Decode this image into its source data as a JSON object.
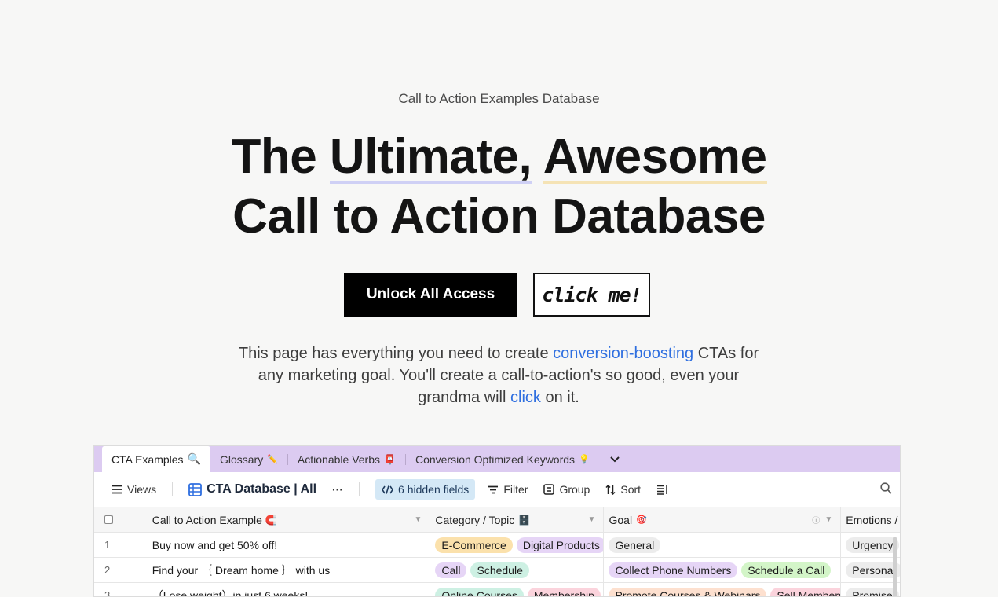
{
  "hero": {
    "eyebrow": "Call to Action Examples Database",
    "title_part1": "The ",
    "title_hl1": "Ultimate,",
    "title_space": " ",
    "title_hl2": "Awesome",
    "title_line2": "Call to Action Database",
    "primary_button": "Unlock All Access",
    "secondary_button": "click me!",
    "blurb_1": "This page has everything you need to create ",
    "blurb_link1": "conversion-boosting",
    "blurb_2": " CTAs for any marketing goal. You'll create a call-to-action's so good, even your grandma will ",
    "blurb_link2": "click",
    "blurb_3": " on it."
  },
  "tabs": [
    {
      "label": "CTA Examples",
      "icon": "🔍"
    },
    {
      "label": "Glossary",
      "icon": "✏️"
    },
    {
      "label": "Actionable Verbs",
      "icon": "📮"
    },
    {
      "label": "Conversion Optimized Keywords",
      "icon": "💡"
    }
  ],
  "toolbar": {
    "views": "Views",
    "database_title": "CTA Database | All",
    "more": "···",
    "hidden_fields": "6 hidden fields",
    "filter": "Filter",
    "group": "Group",
    "sort": "Sort"
  },
  "columns": {
    "cta": "Call to Action Example",
    "cta_icon": "🧲",
    "category": "Category / Topic",
    "category_icon": "🗄️",
    "goal": "Goal",
    "goal_icon": "🎯",
    "emotions": "Emotions /"
  },
  "rows": [
    {
      "num": "1",
      "cta": "Buy now and get 50% off!",
      "cat": [
        {
          "t": "E-Commerce",
          "c": "#fbe1ac"
        },
        {
          "t": "Digital Products",
          "c": "#e6d5f6"
        }
      ],
      "goal": [
        {
          "t": "General",
          "c": "#ececec"
        }
      ],
      "emo": [
        {
          "t": "Urgency",
          "c": "#ececec"
        }
      ]
    },
    {
      "num": "2",
      "cta": "Find your ｛ Dream home ｝ with us",
      "cat": [
        {
          "t": "Call",
          "c": "#e6d5f6"
        },
        {
          "t": "Schedule",
          "c": "#cdf0e3"
        }
      ],
      "goal": [
        {
          "t": "Collect Phone Numbers",
          "c": "#e6d5f6"
        },
        {
          "t": "Schedule a Call",
          "c": "#d3f5c8"
        }
      ],
      "emo": [
        {
          "t": "Personal",
          "c": "#ececec"
        }
      ]
    },
    {
      "num": "3",
      "cta": "（Lose weight）in just 6 weeks!",
      "cat": [
        {
          "t": "Online Courses",
          "c": "#cdf0e3"
        },
        {
          "t": "Membership",
          "c": "#fbd3dc"
        }
      ],
      "goal": [
        {
          "t": "Promote Courses & Webinars",
          "c": "#fde0cf"
        },
        {
          "t": "Sell Membership",
          "c": "#fbd3dc"
        }
      ],
      "emo": [
        {
          "t": "Promise",
          "c": "#ececec"
        }
      ]
    }
  ],
  "colors": {
    "accent_link": "#2f6fe0",
    "tab_bar": "#dccbf1",
    "hidden_pill": "#d4e8f6"
  }
}
